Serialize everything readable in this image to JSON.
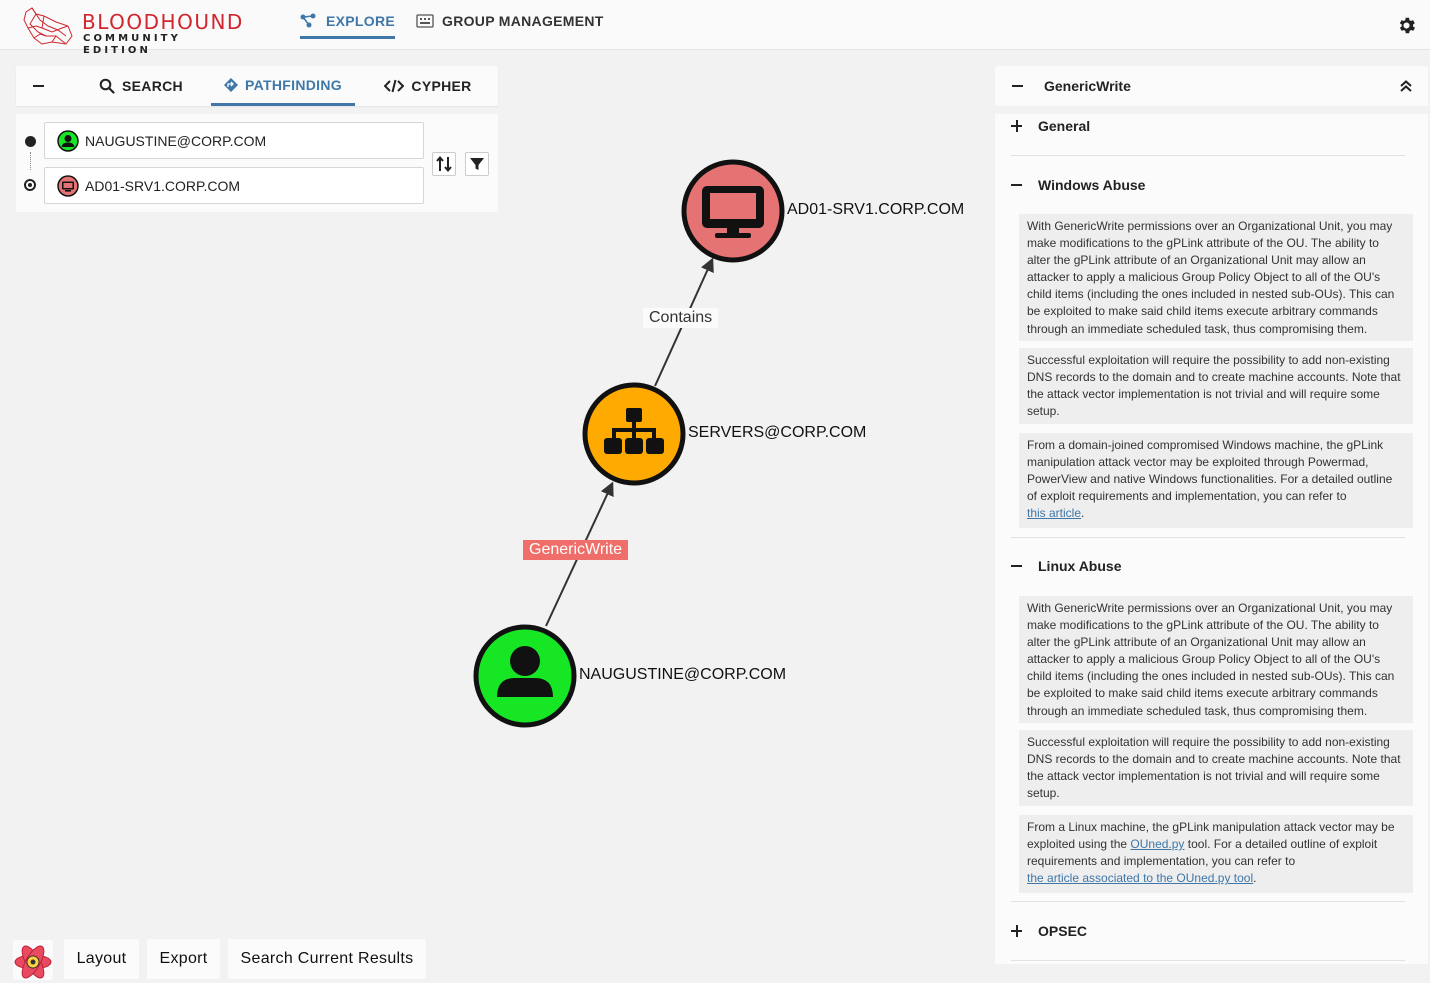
{
  "brand": {
    "title": "BLOODHOUND",
    "subtitle": "COMMUNITY EDITION"
  },
  "nav": {
    "explore": "EXPLORE",
    "group_management": "GROUP MANAGEMENT"
  },
  "search_panel": {
    "tabs": {
      "search": "SEARCH",
      "pathfinding": "PATHFINDING",
      "cypher": "CYPHER"
    },
    "start_node": "NAUGUSTINE@CORP.COM",
    "end_node": "AD01-SRV1.CORP.COM"
  },
  "graph": {
    "nodes": [
      {
        "label": "AD01-SRV1.CORP.COM",
        "type": "Computer",
        "color": "#e57373"
      },
      {
        "label": "SERVERS@CORP.COM",
        "type": "OU",
        "color": "#ffaa00"
      },
      {
        "label": "NAUGUSTINE@CORP.COM",
        "type": "User",
        "color": "#17e625"
      }
    ],
    "edges": [
      {
        "label": "Contains",
        "from": "SERVERS@CORP.COM",
        "to": "AD01-SRV1.CORP.COM"
      },
      {
        "label": "GenericWrite",
        "from": "NAUGUSTINE@CORP.COM",
        "to": "SERVERS@CORP.COM",
        "highlight_color": "#ef6e69"
      }
    ]
  },
  "edge_info": {
    "title": "GenericWrite",
    "sections": {
      "general": "General",
      "windows_abuse": "Windows Abuse",
      "linux_abuse": "Linux Abuse",
      "opsec": "OPSEC"
    },
    "windows_paragraphs": [
      "With GenericWrite permissions over an Organizational Unit, you may make modifications to the gPLink attribute of the OU. The ability to alter the gPLink attribute of an Organizational Unit may allow an attacker to apply a malicious Group Policy Object to all of the OU's child items (including the ones included in nested sub-OUs). This can be exploited to make said child items execute arbitrary commands through an immediate scheduled task, thus compromising them.",
      "Successful exploitation will require the possibility to add non-existing DNS records to the domain and to create machine accounts. Note that the attack vector implementation is not trivial and will require some setup.",
      "From a domain-joined compromised Windows machine, the gPLink manipulation attack vector may be exploited through Powermad, PowerView and native Windows functionalities. For a detailed outline of exploit requirements and implementation, you can refer to"
    ],
    "windows_link": "this article",
    "linux_paragraphs": [
      "With GenericWrite permissions over an Organizational Unit, you may make modifications to the gPLink attribute of the OU. The ability to alter the gPLink attribute of an Organizational Unit may allow an attacker to apply a malicious Group Policy Object to all of the OU's child items (including the ones included in nested sub-OUs). This can be exploited to make said child items execute arbitrary commands through an immediate scheduled task, thus compromising them.",
      "Successful exploitation will require the possibility to add non-existing DNS records to the domain and to create machine accounts. Note that the attack vector implementation is not trivial and will require some setup."
    ],
    "linux_last": {
      "before": "From a Linux machine, the gPLink manipulation attack vector may be exploited using the ",
      "tool_link": "OUned.py",
      "middle": " tool. For a detailed outline of exploit requirements and implementation, you can refer to",
      "article_link": "the article associated to the OUned.py tool"
    }
  },
  "bottom_bar": {
    "layout": "Layout",
    "export": "Export",
    "search_results": "Search Current Results"
  },
  "colors": {
    "accent": "#3e77a8",
    "brand_red": "#d0262d"
  }
}
